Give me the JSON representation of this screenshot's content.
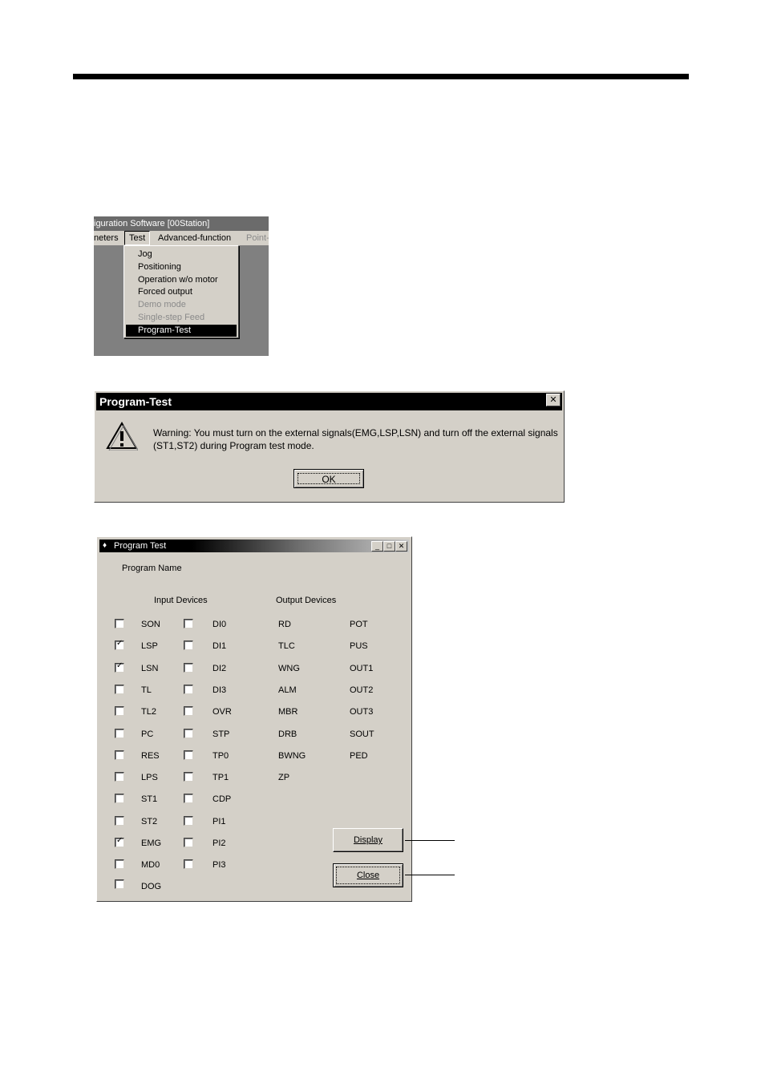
{
  "menu_screenshot": {
    "title": "iguration Software    [00Station]",
    "menubar": {
      "parameters": "neters",
      "test": "Test",
      "advanced": "Advanced-function",
      "point": "Point-"
    },
    "items": [
      {
        "label": "Jog",
        "disabled": false,
        "selected": false
      },
      {
        "label": "Positioning",
        "disabled": false,
        "selected": false
      },
      {
        "label": "Operation w/o motor",
        "disabled": false,
        "selected": false
      },
      {
        "label": "Forced output",
        "disabled": false,
        "selected": false
      },
      {
        "label": "Demo mode",
        "disabled": true,
        "selected": false
      },
      {
        "label": "Single-step Feed",
        "disabled": true,
        "selected": false
      },
      {
        "label": "Program-Test",
        "disabled": false,
        "selected": true
      }
    ]
  },
  "warning_dialog": {
    "title": "Program-Test",
    "message": "Warning: You must turn on the external signals(EMG,LSP,LSN) and turn off the external signals (ST1,ST2) during Program test mode.",
    "ok_label": "OK",
    "close_glyph": "✕"
  },
  "program_test": {
    "title": "Program Test",
    "program_name_label": "Program Name",
    "input_devices_label": "Input Devices",
    "output_devices_label": "Output Devices",
    "inputs_col1": [
      {
        "label": "SON",
        "checked": false
      },
      {
        "label": "LSP",
        "checked": true
      },
      {
        "label": "LSN",
        "checked": true
      },
      {
        "label": "TL",
        "checked": false
      },
      {
        "label": "TL2",
        "checked": false
      },
      {
        "label": "PC",
        "checked": false
      },
      {
        "label": "RES",
        "checked": false
      },
      {
        "label": "LPS",
        "checked": false
      },
      {
        "label": "ST1",
        "checked": false
      },
      {
        "label": "ST2",
        "checked": false
      },
      {
        "label": "EMG",
        "checked": true
      },
      {
        "label": "MD0",
        "checked": false
      },
      {
        "label": "DOG",
        "checked": false
      }
    ],
    "inputs_col2": [
      {
        "label": "DI0",
        "checked": false
      },
      {
        "label": "DI1",
        "checked": false
      },
      {
        "label": "DI2",
        "checked": false
      },
      {
        "label": "DI3",
        "checked": false
      },
      {
        "label": "OVR",
        "checked": false
      },
      {
        "label": "STP",
        "checked": false
      },
      {
        "label": "TP0",
        "checked": false
      },
      {
        "label": "TP1",
        "checked": false
      },
      {
        "label": "CDP",
        "checked": false
      },
      {
        "label": "PI1",
        "checked": false
      },
      {
        "label": "PI2",
        "checked": false
      },
      {
        "label": "PI3",
        "checked": false
      }
    ],
    "outputs_col1": [
      "RD",
      "TLC",
      "WNG",
      "ALM",
      "MBR",
      "DRB",
      "BWNG",
      "ZP"
    ],
    "outputs_col2": [
      "POT",
      "PUS",
      "OUT1",
      "OUT2",
      "OUT3",
      "SOUT",
      "PED"
    ],
    "display_button": "Display",
    "close_button": "Close",
    "window_buttons": {
      "minimize": "_",
      "maximize": "□",
      "close": "✕"
    }
  }
}
